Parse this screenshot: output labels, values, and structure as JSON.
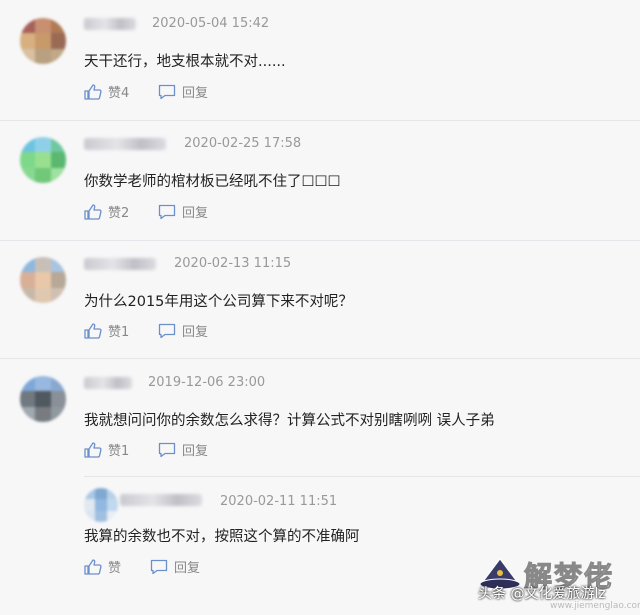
{
  "comments": [
    {
      "time": "2020-05-04 15:42",
      "text": "天干还行，地支根本就不对......",
      "like_label": "赞4",
      "reply_label": "回复",
      "avatar_colors": [
        "#a8615a",
        "#c88f70",
        "#b07a55",
        "#d8b080",
        "#c89a6a",
        "#9a6a55",
        "#d8c0a0",
        "#b8a080",
        "#c0a888"
      ]
    },
    {
      "time": "2020-02-25 17:58",
      "text": "你数学老师的棺材板已经吼不住了☐☐☐",
      "like_label": "赞2",
      "reply_label": "回复",
      "avatar_colors": [
        "#6ec4e0",
        "#8fd0e8",
        "#70c8a0",
        "#7ed88a",
        "#98e090",
        "#5ab870",
        "#88d890",
        "#70c878",
        "#a0e0a0"
      ]
    },
    {
      "time": "2020-02-13 11:15",
      "text": "为什么2015年用这个公司算下来不对呢？",
      "like_label": "赞1",
      "reply_label": "回复",
      "avatar_colors": [
        "#8fb8e0",
        "#c8c0b8",
        "#a8c4e0",
        "#d8b098",
        "#e8c8a8",
        "#b8a898",
        "#c8b8a8",
        "#e0c8b0",
        "#d0c0b0"
      ]
    },
    {
      "time": "2019-12-06 23:00",
      "text": "我就想问问你的余数怎么求得？计算公式不对别瞎咧咧 误人子弟",
      "like_label": "赞1",
      "reply_label": "回复",
      "avatar_colors": [
        "#7ea8d8",
        "#98b8e0",
        "#88a8d0",
        "#707880",
        "#505860",
        "#8a9098",
        "#a0a8b0",
        "#787c80",
        "#9098a0"
      ]
    }
  ],
  "reply": {
    "time": "2020-02-11 11:51",
    "text": "我算的余数也不对，按照这个算的不准确阿",
    "like_label": "赞",
    "reply_label": "回复",
    "avatar_colors": [
      "#a8c8e8",
      "#80a8d0",
      "#b8d0e8",
      "#e0e8f0",
      "#90b8e0",
      "#c0d8f0",
      "#d8e4f0",
      "#a0c0e0",
      "#e8eef4"
    ]
  },
  "watermark": {
    "brand": "解梦佬",
    "source": "头条 @文化爱旅游lz",
    "url": "www.jiemenglao.com"
  }
}
